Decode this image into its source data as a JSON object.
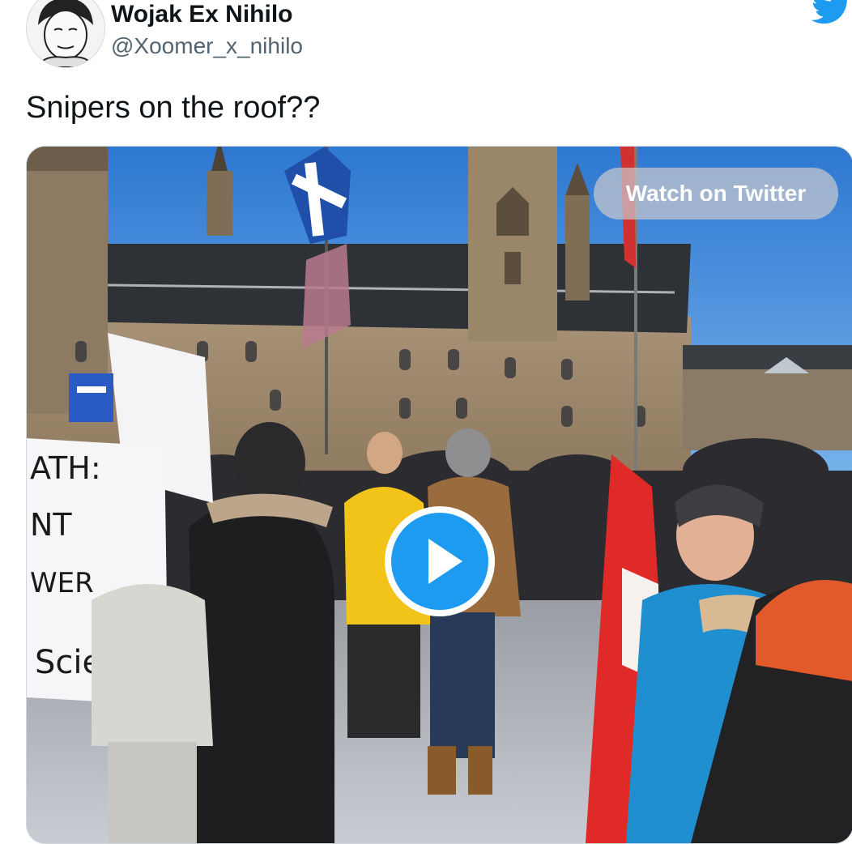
{
  "author": {
    "display_name": "Wojak Ex Nihilo",
    "handle": "@Xoomer_x_nihilo",
    "avatar_icon": "wojak-avatar-icon"
  },
  "brand": {
    "icon": "twitter-bird-icon",
    "color": "#1d9bf0"
  },
  "tweet": {
    "text": "Snipers on the roof??"
  },
  "media": {
    "type": "video",
    "watch_label": "Watch on Twitter",
    "play_icon": "play-icon",
    "play_color": "#1d9bf0",
    "sign_text_lines": [
      "ATH:",
      "NT",
      "WER",
      "Science"
    ]
  }
}
